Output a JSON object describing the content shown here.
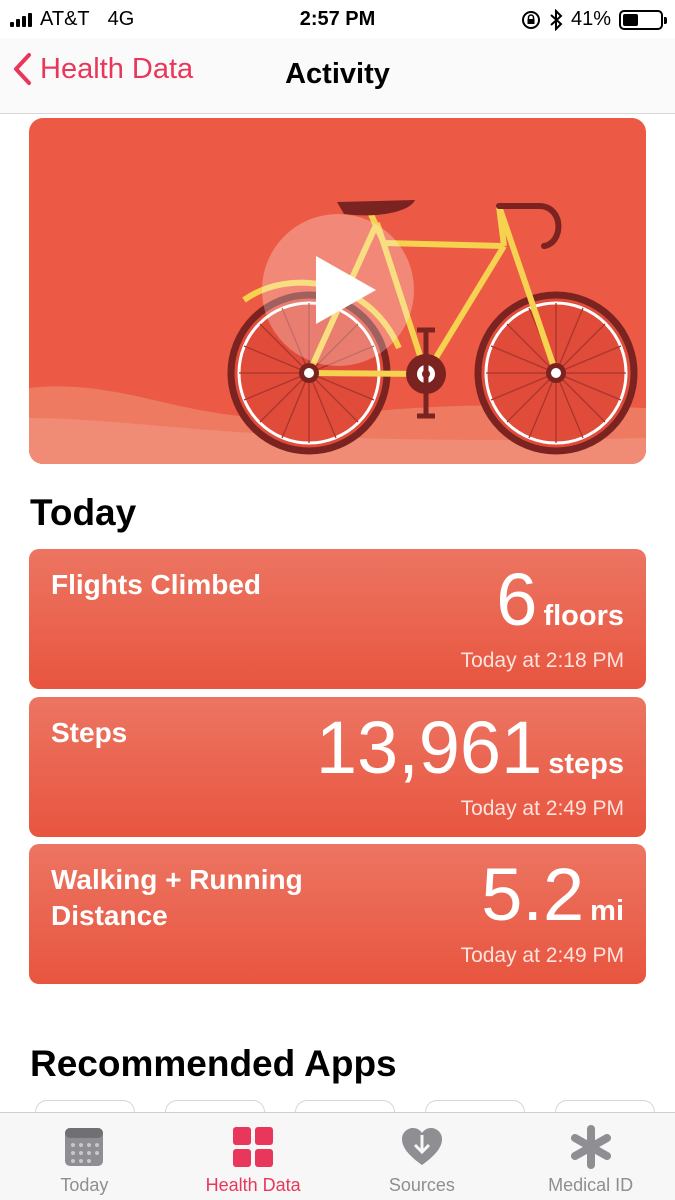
{
  "status_bar": {
    "carrier": "AT&T",
    "network": "4G",
    "time": "2:57 PM",
    "battery_percent": "41%",
    "battery_level": 0.41
  },
  "nav": {
    "back_label": "Health Data",
    "title": "Activity"
  },
  "hero": {
    "media": "bicycle-video-thumbnail",
    "play_icon": "play-icon"
  },
  "today": {
    "title": "Today",
    "metrics": [
      {
        "label": "Flights Climbed",
        "value": "6",
        "unit": "floors",
        "time": "Today at 2:18 PM"
      },
      {
        "label": "Steps",
        "value": "13,961",
        "unit": "steps",
        "time": "Today at 2:49 PM"
      },
      {
        "label": "Walking + Running Distance",
        "value": "5.2",
        "unit": "mi",
        "time": "Today at 2:49 PM"
      }
    ]
  },
  "recommended": {
    "title": "Recommended Apps"
  },
  "tab_bar": {
    "tabs": [
      {
        "label": "Today",
        "icon": "calendar-icon",
        "active": false
      },
      {
        "label": "Health Data",
        "icon": "grid-icon",
        "active": true
      },
      {
        "label": "Sources",
        "icon": "heart-download-icon",
        "active": false
      },
      {
        "label": "Medical ID",
        "icon": "asterisk-icon",
        "active": false
      }
    ]
  },
  "colors": {
    "accent": "#e8375a",
    "card": "#e8553f",
    "hero_bg": "#ec5a45",
    "bike_frame": "#f5d24f",
    "tab_inactive": "#8e8e93"
  }
}
